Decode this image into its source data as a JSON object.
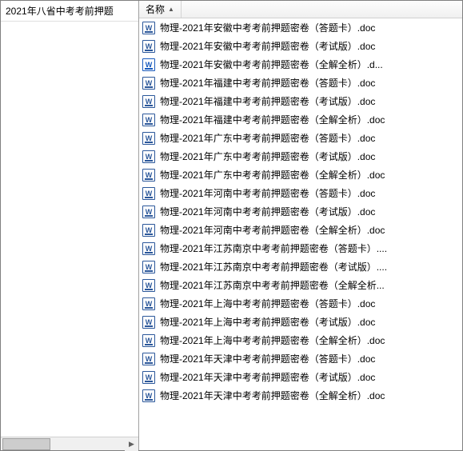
{
  "folder": {
    "name": "2021年八省中考考前押题"
  },
  "header": {
    "name_column": "名称",
    "sort_indicator": "▲"
  },
  "files": [
    {
      "name": "物理-2021年安徽中考考前押题密卷（答题卡）.doc",
      "ext": "doc"
    },
    {
      "name": "物理-2021年安徽中考考前押题密卷（考试版）.doc",
      "ext": "doc"
    },
    {
      "name": "物理-2021年安徽中考考前押题密卷（全解全析）.d...",
      "ext": "docx"
    },
    {
      "name": "物理-2021年福建中考考前押题密卷（答题卡）.doc",
      "ext": "doc"
    },
    {
      "name": "物理-2021年福建中考考前押题密卷（考试版）.doc",
      "ext": "doc"
    },
    {
      "name": "物理-2021年福建中考考前押题密卷（全解全析）.doc",
      "ext": "doc"
    },
    {
      "name": "物理-2021年广东中考考前押题密卷（答题卡）.doc",
      "ext": "doc"
    },
    {
      "name": "物理-2021年广东中考考前押题密卷（考试版）.doc",
      "ext": "doc"
    },
    {
      "name": "物理-2021年广东中考考前押题密卷（全解全析）.doc",
      "ext": "doc"
    },
    {
      "name": "物理-2021年河南中考考前押题密卷（答题卡）.doc",
      "ext": "doc"
    },
    {
      "name": "物理-2021年河南中考考前押题密卷（考试版）.doc",
      "ext": "doc"
    },
    {
      "name": "物理-2021年河南中考考前押题密卷（全解全析）.doc",
      "ext": "doc"
    },
    {
      "name": "物理-2021年江苏南京中考考前押题密卷（答题卡）....",
      "ext": "doc"
    },
    {
      "name": "物理-2021年江苏南京中考考前押题密卷（考试版）....",
      "ext": "doc"
    },
    {
      "name": "物理-2021年江苏南京中考考前押题密卷（全解全析...",
      "ext": "doc"
    },
    {
      "name": "物理-2021年上海中考考前押题密卷（答题卡）.doc",
      "ext": "doc"
    },
    {
      "name": "物理-2021年上海中考考前押题密卷（考试版）.doc",
      "ext": "doc"
    },
    {
      "name": "物理-2021年上海中考考前押题密卷（全解全析）.doc",
      "ext": "doc"
    },
    {
      "name": "物理-2021年天津中考考前押题密卷（答题卡）.doc",
      "ext": "doc"
    },
    {
      "name": "物理-2021年天津中考考前押题密卷（考试版）.doc",
      "ext": "doc"
    },
    {
      "name": "物理-2021年天津中考考前押题密卷（全解全析）.doc",
      "ext": "doc"
    }
  ]
}
